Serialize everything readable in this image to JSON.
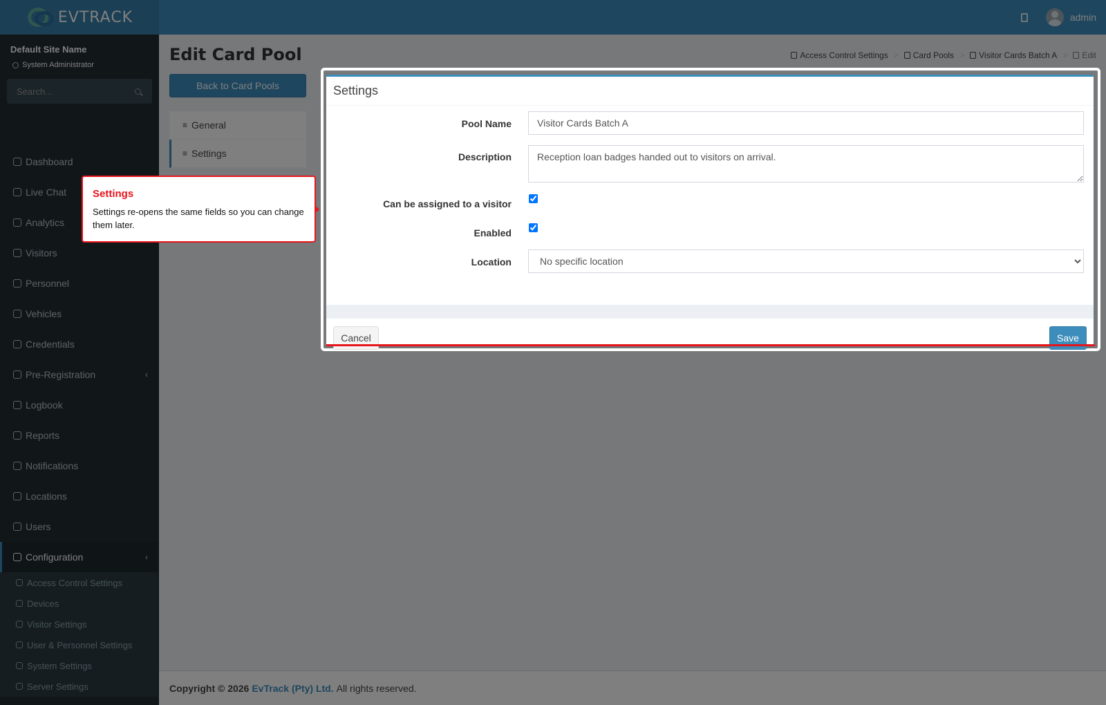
{
  "brand": {
    "name": "EVTRACK"
  },
  "header": {
    "username": "admin"
  },
  "sidebar": {
    "site_name": "Default Site Name",
    "role": "System Administrator",
    "search_placeholder": "Search...",
    "items": [
      {
        "label": "Dashboard",
        "icon": "dashboard-icon"
      },
      {
        "label": "Live Chat",
        "icon": "headset-icon"
      },
      {
        "label": "Analytics",
        "icon": "analytics-icon"
      },
      {
        "label": "Visitors",
        "icon": "eye-icon"
      },
      {
        "label": "Personnel",
        "icon": "personnel-icon"
      },
      {
        "label": "Vehicles",
        "icon": "car-icon"
      },
      {
        "label": "Credentials",
        "icon": "credential-icon"
      },
      {
        "label": "Pre-Registration",
        "icon": "arrows-icon",
        "expandable": true
      },
      {
        "label": "Logbook",
        "icon": "book-icon"
      },
      {
        "label": "Reports",
        "icon": "reports-icon"
      },
      {
        "label": "Notifications",
        "icon": "chat-icon"
      },
      {
        "label": "Locations",
        "icon": "building-icon"
      },
      {
        "label": "Users",
        "icon": "users-icon"
      },
      {
        "label": "Configuration",
        "icon": "gear-icon",
        "expandable": true,
        "active": true
      }
    ],
    "sub_items": [
      {
        "label": "Access Control Settings",
        "icon": "lock-icon"
      },
      {
        "label": "Devices",
        "icon": "gear-icon"
      },
      {
        "label": "Visitor Settings",
        "icon": "eye-icon"
      },
      {
        "label": "User & Personnel Settings",
        "icon": "users-icon"
      },
      {
        "label": "System Settings",
        "icon": "sliders-icon"
      },
      {
        "label": "Server Settings",
        "icon": "server-icon"
      }
    ]
  },
  "page": {
    "title": "Edit Card Pool",
    "back_label": "Back to Card Pools",
    "breadcrumb": [
      "Access Control Settings",
      "Card Pools",
      "Visitor Cards Batch A",
      "Edit"
    ],
    "tabs": [
      "General",
      "Settings"
    ]
  },
  "panel": {
    "title": "Settings",
    "pool_name_label": "Pool Name",
    "pool_name_value": "Visitor Cards Batch A",
    "description_label": "Description",
    "description_value": "Reception loan badges handed out to visitors on arrival.",
    "visitor_label": "Can be assigned to a visitor",
    "visitor_checked": true,
    "enabled_label": "Enabled",
    "enabled_checked": true,
    "location_label": "Location",
    "location_value": "No specific location",
    "cancel_label": "Cancel",
    "save_label": "Save"
  },
  "tooltip": {
    "title": "Settings",
    "text": "Settings re-opens the same fields so you can change them later."
  },
  "footer": {
    "copyright": "Copyright © 2026",
    "company": "EvTrack (Pty) Ltd.",
    "rights": "All rights reserved."
  },
  "colors": {
    "primary": "#3c8dbc",
    "sidebar": "#222d32",
    "tour_accent": "#e8141b"
  }
}
